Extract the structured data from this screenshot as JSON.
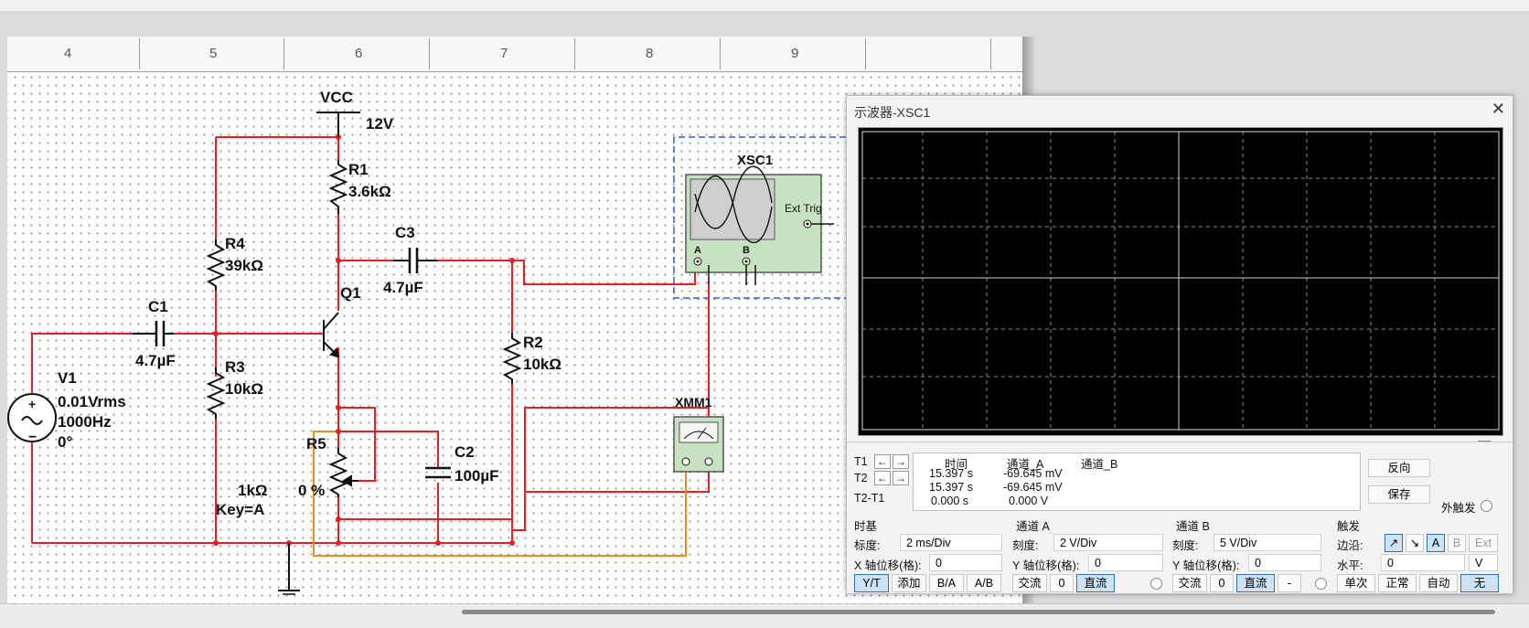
{
  "schematic": {
    "ruler_labels": [
      "4",
      "5",
      "6",
      "7",
      "8",
      "9"
    ],
    "labels": {
      "vcc": "VCC",
      "vcc_value": "12V",
      "r1": "R1",
      "r1_value": "3.6kΩ",
      "r4": "R4",
      "r4_value": "39kΩ",
      "c3": "C3",
      "c3_value": "4.7µF",
      "q1": "Q1",
      "c1": "C1",
      "c1_value": "4.7µF",
      "r3": "R3",
      "r3_value": "10kΩ",
      "r2": "R2",
      "r2_value": "10kΩ",
      "v1": "V1",
      "v1_amp": "0.01Vrms",
      "v1_freq": "1000Hz",
      "v1_phase": "0°",
      "r5": "R5",
      "r5_value": "1kΩ",
      "r5_pct": "0 %",
      "r5_key": "Key=A",
      "c2": "C2",
      "c2_value": "100µF",
      "xsc1": "XSC1",
      "ext_trig": "Ext Trig",
      "ch_a": "A",
      "ch_b": "B",
      "xmm1": "XMM1"
    },
    "colors": {
      "wire": "#ee1c1c",
      "meter_wire": "#f08a1f",
      "instrument_fill": "#c6e2c0",
      "probe_box": "#3a55e0"
    }
  },
  "oscilloscope": {
    "title": "示波器-XSC1",
    "close": "✕",
    "cursor_table": {
      "headers": [
        "时间",
        "通道_A",
        "通道_B"
      ],
      "rows": [
        {
          "label": "T1",
          "time": "15.397 s",
          "a": "-69.645 mV",
          "b": ""
        },
        {
          "label": "T2",
          "time": "15.397 s",
          "a": "-69.645 mV",
          "b": ""
        },
        {
          "label": "T2-T1",
          "time": "0.000 s",
          "a": "0.000 V",
          "b": ""
        }
      ]
    },
    "buttons": {
      "reverse": "反向",
      "save": "保存",
      "ext_trigger": "外触发"
    },
    "timebase": {
      "title": "时基",
      "scale_label": "标度:",
      "scale": "2 ms/Div",
      "xpos_label": "X 轴位移(格):",
      "xpos": "0",
      "modes": [
        "Y/T",
        "添加",
        "B/A",
        "A/B"
      ]
    },
    "channel_a": {
      "title": "通道 A",
      "scale_label": "刻度:",
      "scale": "2  V/Div",
      "ypos_label": "Y 轴位移(格):",
      "ypos": "0",
      "coupling": [
        "交流",
        "0",
        "直流"
      ]
    },
    "channel_b": {
      "title": "通道 B",
      "scale_label": "刻度:",
      "scale": "5  V/Div",
      "ypos_label": "Y 轴位移(格):",
      "ypos": "0",
      "coupling": [
        "交流",
        "0",
        "直流",
        "-"
      ]
    },
    "trigger": {
      "title": "触发",
      "edge_label": "边沿:",
      "edge_rise": "↗",
      "edge_fall": "↘",
      "src_a": "A",
      "src_b": "B",
      "src_ext": "Ext",
      "level_label": "水平:",
      "level": "0",
      "level_unit": "V",
      "modes": [
        "单次",
        "正常",
        "自动",
        "无"
      ]
    }
  }
}
